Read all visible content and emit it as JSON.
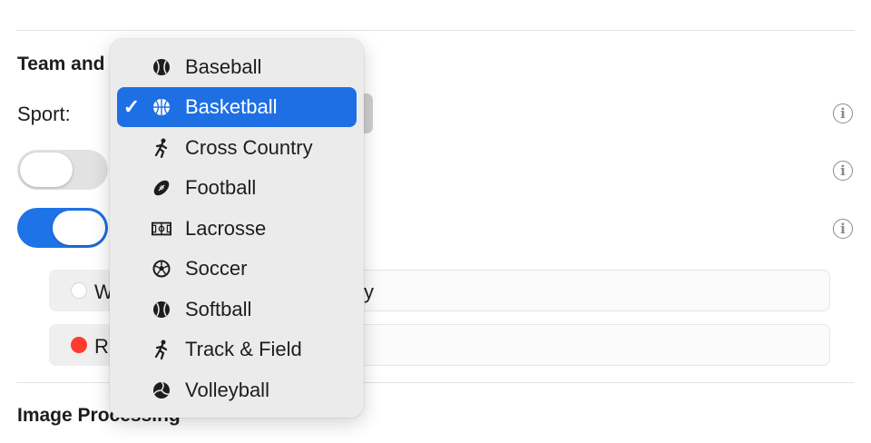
{
  "section_team": {
    "title": "Team and"
  },
  "sport": {
    "label": "Sport:"
  },
  "toggles": [
    {
      "state": "off"
    },
    {
      "state": "on"
    }
  ],
  "fields": [
    {
      "segment_text": "W",
      "dot_color": "#ffffff",
      "tail_text": "y"
    },
    {
      "segment_text": "R",
      "dot_color": "#ff3b30",
      "tail_text": ""
    }
  ],
  "section_image": {
    "title": "Image Processing"
  },
  "info_icon": "info-circle-icon",
  "accent_color": "#1e6fe4",
  "sport_menu": {
    "selected": "Basketball",
    "items": [
      {
        "label": "Baseball",
        "icon": "baseball-icon"
      },
      {
        "label": "Basketball",
        "icon": "basketball-icon"
      },
      {
        "label": "Cross Country",
        "icon": "runner-icon"
      },
      {
        "label": "Football",
        "icon": "football-icon"
      },
      {
        "label": "Lacrosse",
        "icon": "field-icon"
      },
      {
        "label": "Soccer",
        "icon": "soccer-ball-icon"
      },
      {
        "label": "Softball",
        "icon": "softball-icon"
      },
      {
        "label": "Track & Field",
        "icon": "runner-icon"
      },
      {
        "label": "Volleyball",
        "icon": "volleyball-icon"
      }
    ]
  }
}
